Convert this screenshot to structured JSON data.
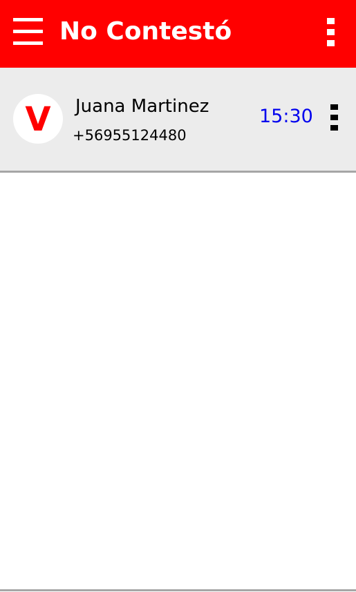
{
  "app": {
    "title": "No Contestó",
    "accent_color": "#ff0000",
    "menu_icon": "hamburger-menu-icon",
    "more_icon": "more-vertical-icon"
  },
  "calls": [
    {
      "avatar_letter": "V",
      "avatar_color": "#ff0000",
      "name": "Juana Martinez",
      "phone": "+56955124480",
      "time": "15:30",
      "time_color": "#0000ee",
      "more_icon": "more-vertical-icon"
    }
  ]
}
